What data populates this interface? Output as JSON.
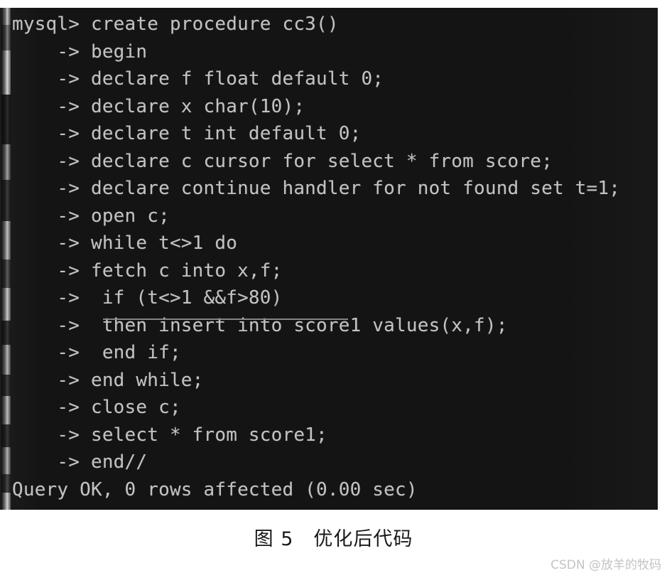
{
  "figure": {
    "caption": "图 5　优化后代码",
    "caption_label": "图 5",
    "caption_title": "优化后代码"
  },
  "watermark": {
    "text": "CSDN @放羊的牧码"
  },
  "terminal": {
    "background_color": "#141414",
    "text_color": "#c2c2c2",
    "prompt": "mysql>",
    "continuation_prompt": "->",
    "lines": [
      "mysql> create procedure cc3()",
      "    -> begin",
      "    -> declare f float default 0;",
      "    -> declare x char(10);",
      "    -> declare t int default 0;",
      "    -> declare c cursor for select * from score;",
      "    -> declare continue handler for not found set t=1;",
      "    -> open c;",
      "    -> while t<>1 do",
      "    -> fetch c into x,f;",
      "    ->  if (t<>1 &&f>80)",
      "    ->  then insert into score1 values(x,f);",
      "    ->  end if;",
      "    -> end while;",
      "    -> close c;",
      "    -> select * from score1;",
      "    -> end//",
      "Query OK, 0 rows affected (0.00 sec)"
    ],
    "result_status": "Query OK, 0 rows affected (0.00 sec)",
    "annotation": {
      "type": "underline",
      "target_line": "    ->  if (t<>1 &&f>80)",
      "color": "#8e8e8e"
    }
  },
  "scrollbar": {
    "orientation": "vertical",
    "position": "left"
  }
}
